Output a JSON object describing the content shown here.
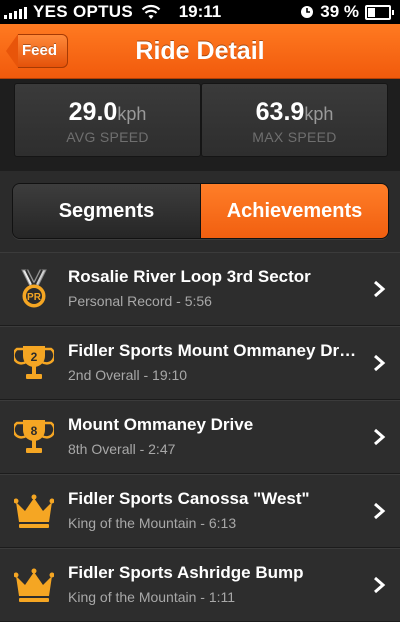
{
  "status_bar": {
    "carrier": "YES OPTUS",
    "time": "19:11",
    "battery": "39 %",
    "battery_level": 0.39
  },
  "nav": {
    "back_label": "Feed",
    "title": "Ride Detail"
  },
  "stats": {
    "avg": {
      "value": "29.0",
      "unit": "kph",
      "label": "AVG SPEED"
    },
    "max": {
      "value": "63.9",
      "unit": "kph",
      "label": "MAX SPEED"
    }
  },
  "tabs": {
    "segments": "Segments",
    "achievements": "Achievements",
    "selected": "achievements"
  },
  "achievements": [
    {
      "icon": "pr-medal-icon",
      "badge": "PR",
      "title": "Rosalie River Loop 3rd Sector",
      "subtitle": "Personal Record - 5:56"
    },
    {
      "icon": "trophy-icon",
      "badge": "2",
      "title": "Fidler Sports Mount Ommaney Drive",
      "subtitle": "2nd Overall - 19:10"
    },
    {
      "icon": "trophy-icon",
      "badge": "8",
      "title": "Mount Ommaney Drive",
      "subtitle": "8th Overall - 2:47"
    },
    {
      "icon": "crown-icon",
      "badge": "",
      "title": "Fidler Sports Canossa \"West\"",
      "subtitle": "King of the Mountain - 6:13"
    },
    {
      "icon": "crown-icon",
      "badge": "",
      "title": "Fidler Sports Ashridge Bump",
      "subtitle": "King of the Mountain - 1:11"
    }
  ],
  "colors": {
    "accent": "#f26b1d",
    "gold": "#f5a623",
    "background": "#2b2b2b"
  }
}
